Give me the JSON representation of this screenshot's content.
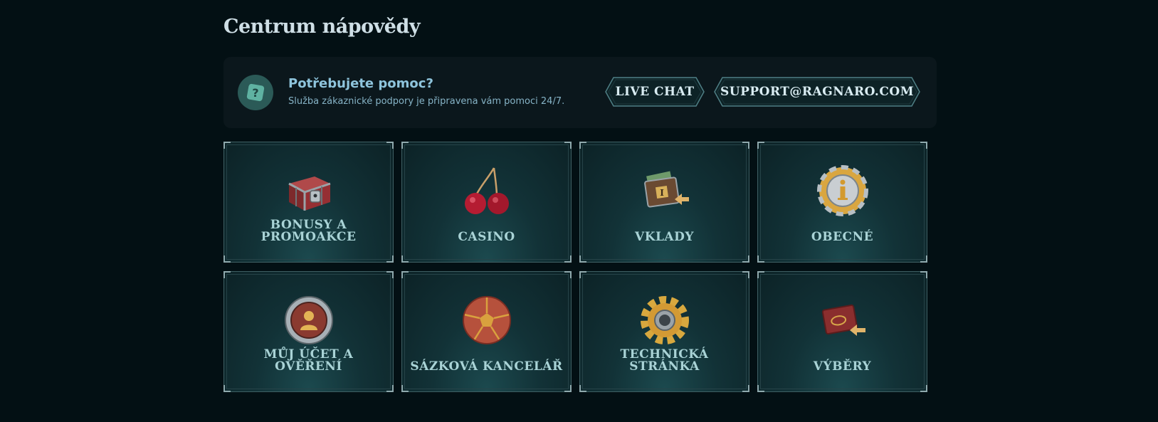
{
  "page": {
    "title": "Centrum nápovědy"
  },
  "help": {
    "title": "Potřebujete pomoc?",
    "subtitle": "Služba zákaznické podpory je připravena vám pomoci 24/7.",
    "icon": "question-icon",
    "live_chat_label": "LIVE CHAT",
    "email_label": "SUPPORT@RAGNARO.COM"
  },
  "categories": [
    {
      "label": "BONUSY A PROMOAKCE",
      "icon": "treasure-chest-icon"
    },
    {
      "label": "CASINO",
      "icon": "cherries-icon"
    },
    {
      "label": "VKLADY",
      "icon": "deposit-wallet-icon"
    },
    {
      "label": "OBECNÉ",
      "icon": "info-coin-icon"
    },
    {
      "label": "MŮJ ÚČET A OVĚŘENÍ",
      "icon": "user-account-icon"
    },
    {
      "label": "SÁZKOVÁ KANCELÁŘ",
      "icon": "football-icon"
    },
    {
      "label": "TECHNICKÁ STRÁNKA",
      "icon": "gear-icon"
    },
    {
      "label": "VÝBĚRY",
      "icon": "withdrawal-wallet-icon"
    }
  ],
  "colors": {
    "background": "#031014",
    "card": "#123237",
    "accent": "#a9d3d6"
  }
}
